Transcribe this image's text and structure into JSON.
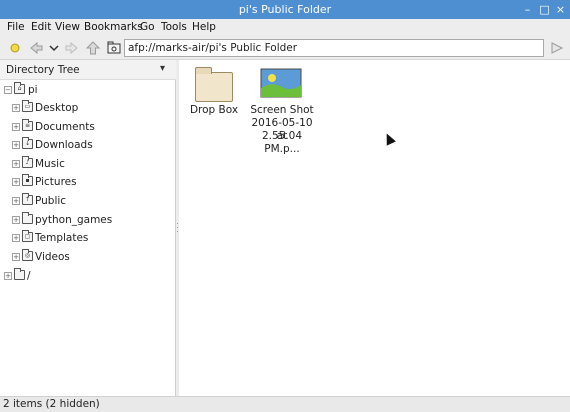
{
  "window": {
    "title": "pi's Public Folder",
    "controls": {
      "minimize": "–",
      "maximize": "□",
      "close": "×"
    }
  },
  "menubar": [
    "File",
    "Edit",
    "View",
    "Bookmarks",
    "Go",
    "Tools",
    "Help"
  ],
  "toolbar": {
    "address": "afp://marks-air/pi's Public Folder",
    "icons": [
      "new-tab-icon",
      "back-icon",
      "history-dropdown-icon",
      "forward-icon",
      "up-icon",
      "location-icon",
      "go-icon"
    ]
  },
  "sidebar": {
    "header": "Directory Tree",
    "root": {
      "label": "pi",
      "expander": "−"
    },
    "items": [
      {
        "label": "Desktop",
        "icon": "desktop-folder-icon",
        "glyph": "▭",
        "expander": "+"
      },
      {
        "label": "Documents",
        "icon": "documents-folder-icon",
        "glyph": "≡",
        "expander": "+"
      },
      {
        "label": "Downloads",
        "icon": "downloads-folder-icon",
        "glyph": "↓",
        "expander": "+"
      },
      {
        "label": "Music",
        "icon": "music-folder-icon",
        "glyph": "♪",
        "expander": "+"
      },
      {
        "label": "Pictures",
        "icon": "pictures-folder-icon",
        "glyph": "▪",
        "expander": "+"
      },
      {
        "label": "Public",
        "icon": "public-folder-icon",
        "glyph": "↑",
        "expander": "+"
      },
      {
        "label": "python_games",
        "icon": "folder-icon",
        "glyph": "",
        "expander": "+"
      },
      {
        "label": "Templates",
        "icon": "templates-folder-icon",
        "glyph": "▢",
        "expander": "+"
      },
      {
        "label": "Videos",
        "icon": "videos-folder-icon",
        "glyph": "◎",
        "expander": "+"
      }
    ],
    "filesystem_root": {
      "label": "/",
      "expander": "+"
    }
  },
  "files": [
    {
      "name": "Drop Box",
      "type": "folder",
      "lines": [
        "Drop Box"
      ]
    },
    {
      "name": "Screen Shot 2016-05-10 at 2.55.04 PM.p...",
      "type": "image",
      "lines": [
        "Screen Shot",
        "2016-05-10 at",
        "2.55.04 PM.p..."
      ]
    }
  ],
  "status": "2 items (2 hidden)",
  "colors": {
    "titlebar": "#4d8fd1",
    "folder": "#f1e6cc",
    "image_sky": "#5b9bd6",
    "image_grass": "#6cbf3a",
    "image_sun": "#f2e24a"
  }
}
